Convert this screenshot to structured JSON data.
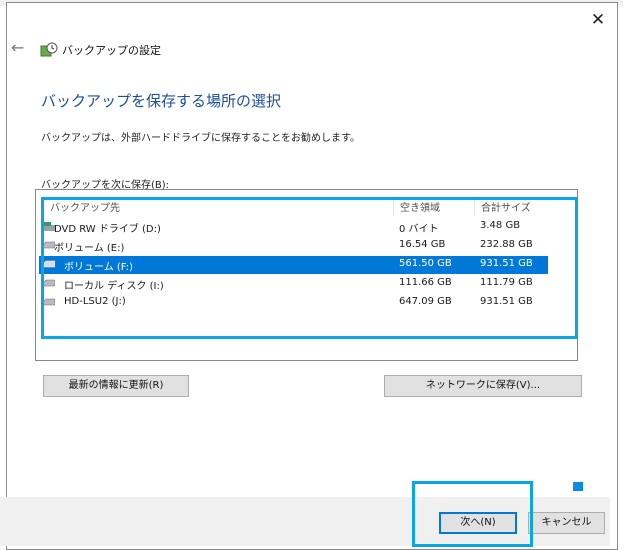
{
  "window": {
    "title": "バックアップの設定",
    "close_glyph": "✕",
    "back_glyph": "←"
  },
  "page": {
    "heading": "バックアップを保存する場所の選択",
    "description": "バックアップは、外部ハードドライブに保存することをお勧めします。",
    "list_label": "バックアップを次に保存(B):"
  },
  "table": {
    "columns": [
      "バックアップ先",
      "空き領域",
      "合計サイズ"
    ],
    "rows": [
      {
        "name": "DVD RW ドライブ (D:)",
        "free": "0 バイト",
        "total": "3.48 GB",
        "icon": "dvd-drive-icon",
        "selected": false
      },
      {
        "name": "ボリューム (E:)",
        "free": "16.54 GB",
        "total": "232.88 GB",
        "icon": "drive-icon",
        "selected": false
      },
      {
        "name": "ボリューム (F:)",
        "free": "561.50 GB",
        "total": "931.51 GB",
        "icon": "drive-icon",
        "selected": true
      },
      {
        "name": "ローカル ディスク (I:)",
        "free": "111.66 GB",
        "total": "111.79 GB",
        "icon": "drive-icon",
        "selected": false
      },
      {
        "name": "HD-LSU2 (J:)",
        "free": "647.09 GB",
        "total": "931.51 GB",
        "icon": "drive-icon",
        "selected": false
      }
    ]
  },
  "buttons": {
    "refresh": "最新の情報に更新(R)",
    "network": "ネットワークに保存(V)...",
    "next": "次へ(N)",
    "cancel": "キャンセル"
  },
  "colors": {
    "heading": "#1b4f9c",
    "selection": "#0078d7",
    "highlight_frame": "#0aa5e3"
  }
}
